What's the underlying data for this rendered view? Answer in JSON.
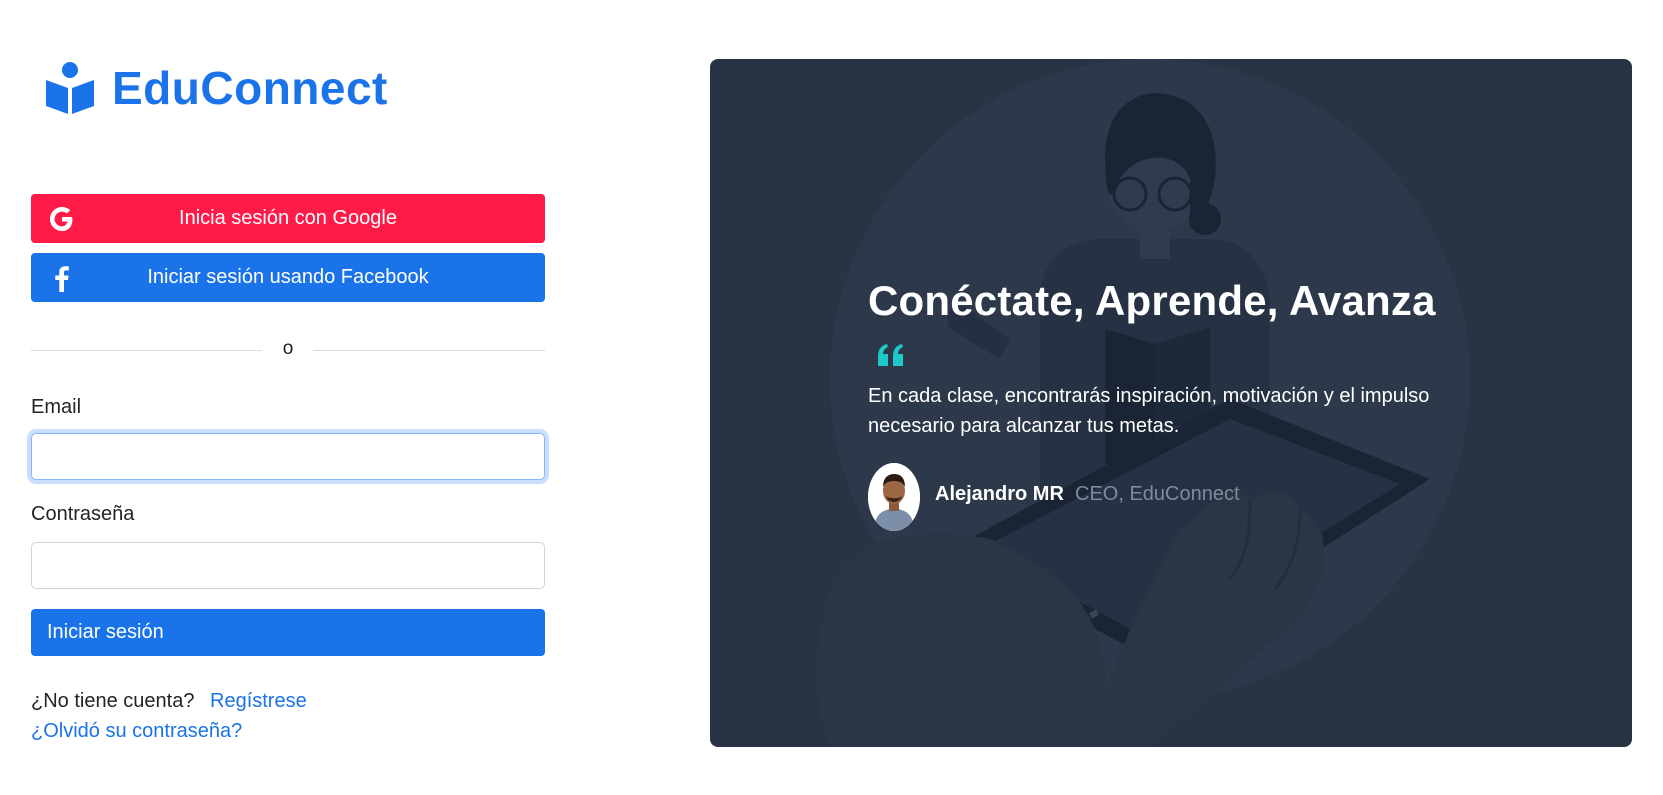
{
  "brand": {
    "name": "EduConnect",
    "color": "#1a73e8"
  },
  "auth": {
    "google_button": "Inicia sesión con Google",
    "facebook_button": "Iniciar sesión usando Facebook",
    "divider_text": "o",
    "email_label": "Email",
    "email_value": "",
    "password_label": "Contraseña",
    "password_value": "",
    "submit_button": "Iniciar sesión",
    "register_prompt": "¿No tiene cuenta?",
    "register_link": "Regístrese",
    "forgot_link": "¿Olvidó su contraseña?"
  },
  "hero": {
    "title": "Conéctate, Aprende, Avanza",
    "quote": "En cada clase, encontrarás inspiración, motivación y el impulso necesario para alcanzar tus metas.",
    "author_name": "Alejandro MR",
    "author_role": "CEO, EduConnect"
  },
  "colors": {
    "google": "#ff1a47",
    "primary": "#1a73e8",
    "hero_bg": "#283344",
    "quote_accent": "#1fc8c8"
  },
  "icons": {
    "logo": "reader-book-icon",
    "google": "google-g-icon",
    "facebook": "facebook-f-icon",
    "quote": "quote-icon"
  }
}
